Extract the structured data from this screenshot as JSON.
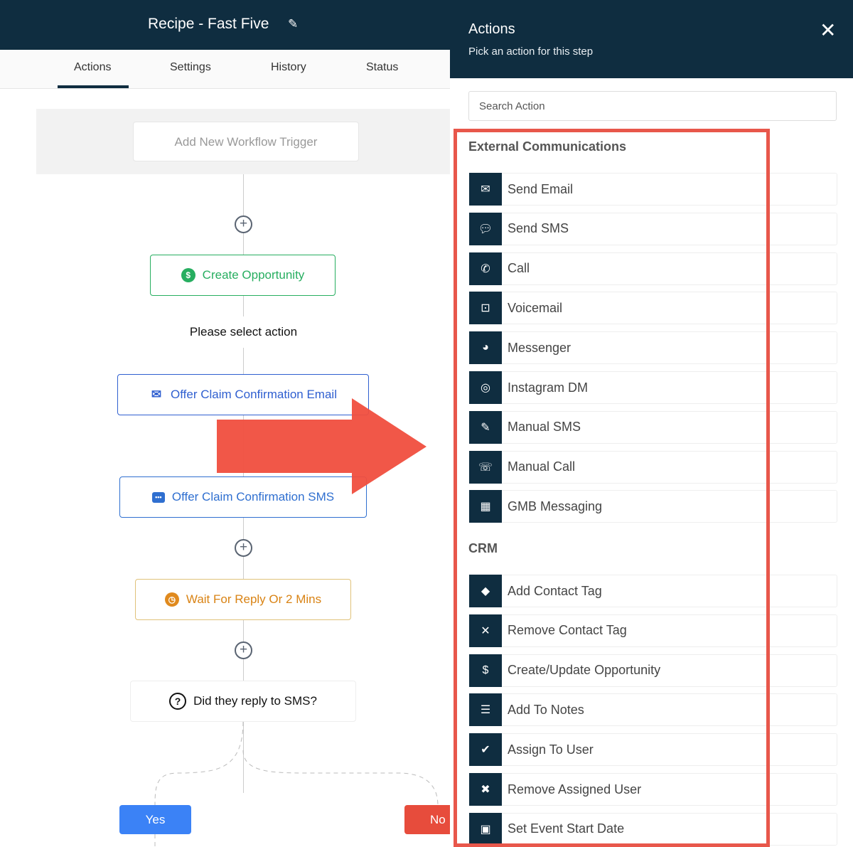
{
  "workflow": {
    "title": "Recipe - Fast Five",
    "tabs": [
      {
        "label": "Actions",
        "active": true
      },
      {
        "label": "Settings"
      },
      {
        "label": "History"
      },
      {
        "label": "Status"
      }
    ],
    "trigger_label": "Add New Workflow Trigger",
    "steps": {
      "create_opportunity": "Create Opportunity",
      "please_select": "Please select action",
      "offer_email": "Offer Claim Confirmation Email",
      "offer_sms": "Offer Claim Confirmation SMS",
      "wait": "Wait For Reply Or 2 Mins",
      "condition": "Did they reply to SMS?",
      "yes": "Yes",
      "no": "No"
    }
  },
  "panel": {
    "title": "Actions",
    "subtitle": "Pick an action for this step",
    "search_placeholder": "Search Action",
    "sections": [
      {
        "title": "External Communications",
        "items": [
          {
            "label": "Send Email",
            "icon": "envelope-open-icon"
          },
          {
            "label": "Send SMS",
            "icon": "chat-bubble-icon"
          },
          {
            "label": "Call",
            "icon": "phone-icon"
          },
          {
            "label": "Voicemail",
            "icon": "voicemail-icon"
          },
          {
            "label": "Messenger",
            "icon": "messenger-icon"
          },
          {
            "label": "Instagram DM",
            "icon": "instagram-icon"
          },
          {
            "label": "Manual SMS",
            "icon": "edit-message-icon"
          },
          {
            "label": "Manual Call",
            "icon": "phone-circle-icon"
          },
          {
            "label": "GMB Messaging",
            "icon": "store-icon"
          }
        ]
      },
      {
        "title": "CRM",
        "items": [
          {
            "label": "Add Contact Tag",
            "icon": "tag-icon"
          },
          {
            "label": "Remove Contact Tag",
            "icon": "tag-remove-icon"
          },
          {
            "label": "Create/Update Opportunity",
            "icon": "dollar-icon"
          },
          {
            "label": "Add To Notes",
            "icon": "note-icon"
          },
          {
            "label": "Assign To User",
            "icon": "user-check-icon"
          },
          {
            "label": "Remove Assigned User",
            "icon": "user-remove-icon"
          },
          {
            "label": "Set Event Start Date",
            "icon": "calendar-icon"
          }
        ]
      }
    ]
  },
  "colors": {
    "header": "#0f2d40",
    "highlight": "#e8574b",
    "green": "#27ae60",
    "blue": "#2f5fd0",
    "orange": "#e08a1e",
    "yes": "#3b82f6",
    "no": "#e74c3c"
  }
}
